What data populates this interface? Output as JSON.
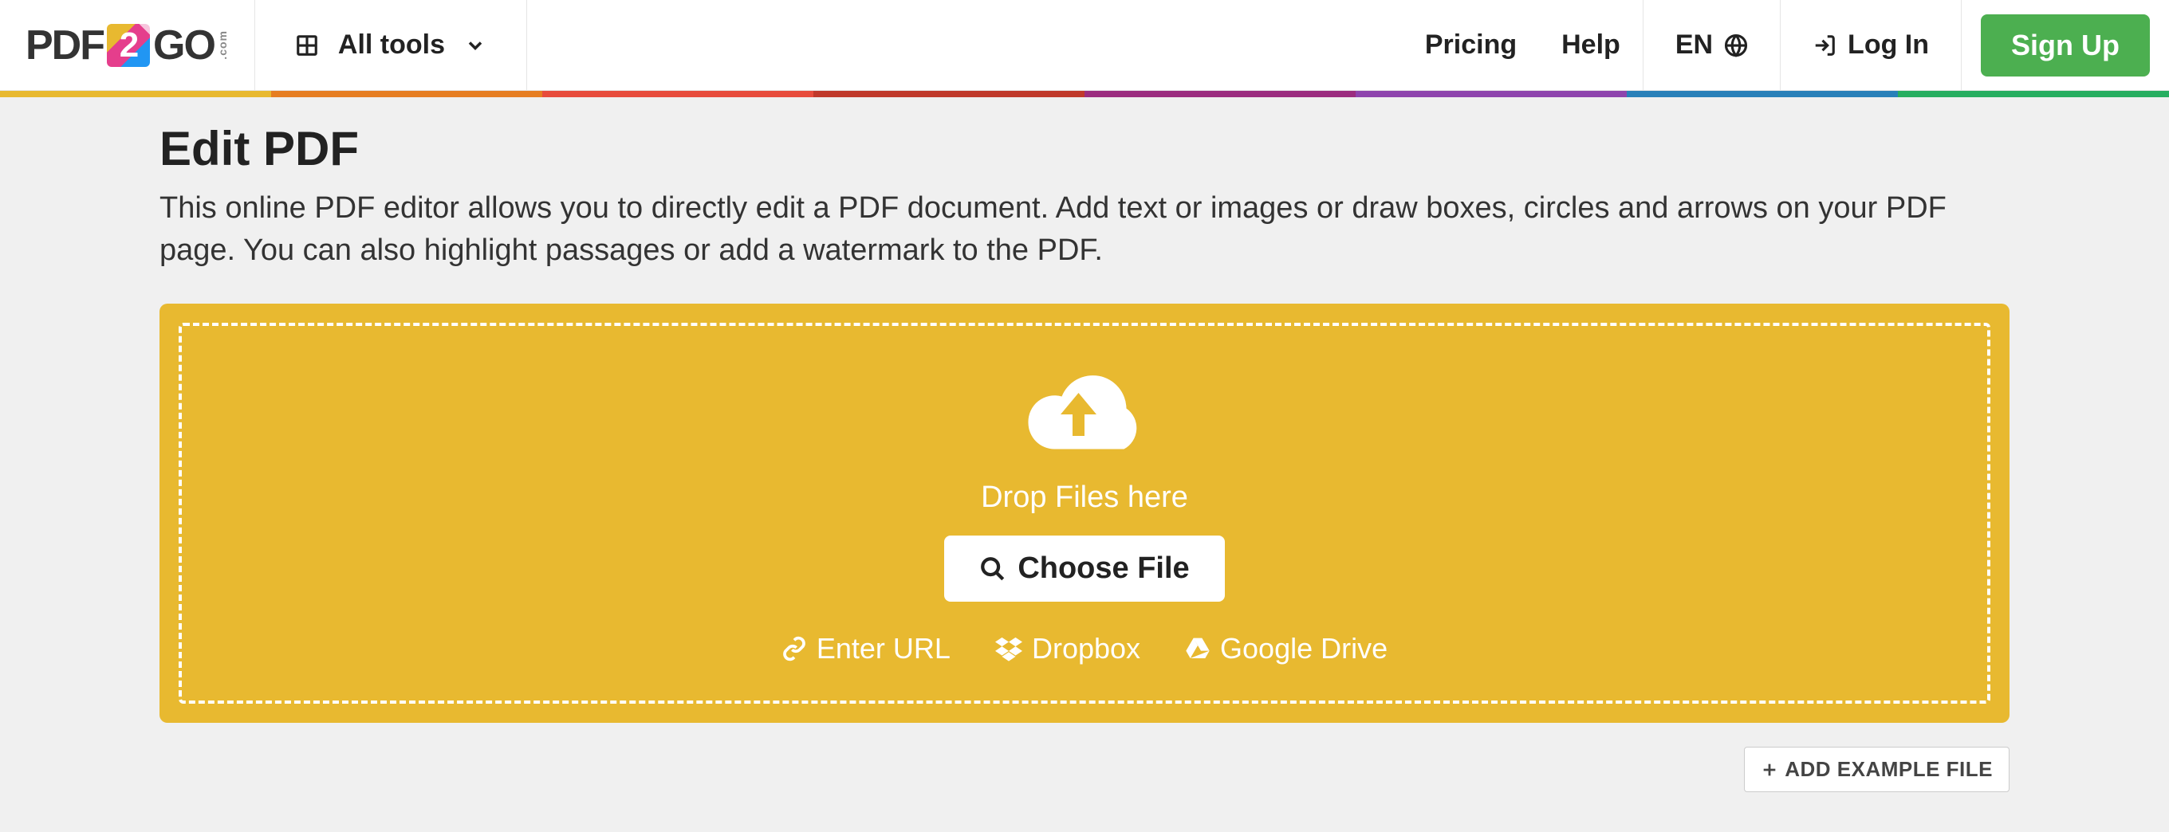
{
  "header": {
    "logo_pdf": "PDF",
    "logo_go": "GO",
    "logo_2": "2",
    "logo_com": ".com",
    "alltools": "All tools",
    "pricing": "Pricing",
    "help": "Help",
    "language": "EN",
    "login": "Log In",
    "signup": "Sign Up"
  },
  "page": {
    "title": "Edit PDF",
    "subtitle": "This online PDF editor allows you to directly edit a PDF document. Add text or images or draw boxes, circles and arrows on your PDF page. You can also highlight passages or add a watermark to the PDF."
  },
  "dropzone": {
    "drop_text": "Drop Files here",
    "choose_file": "Choose File",
    "sources": {
      "url": "Enter URL",
      "dropbox": "Dropbox",
      "gdrive": "Google Drive"
    }
  },
  "footer": {
    "example": "ADD EXAMPLE FILE"
  },
  "colors": {
    "accent_yellow": "#e8b930",
    "signup_green": "#4CAF50"
  }
}
